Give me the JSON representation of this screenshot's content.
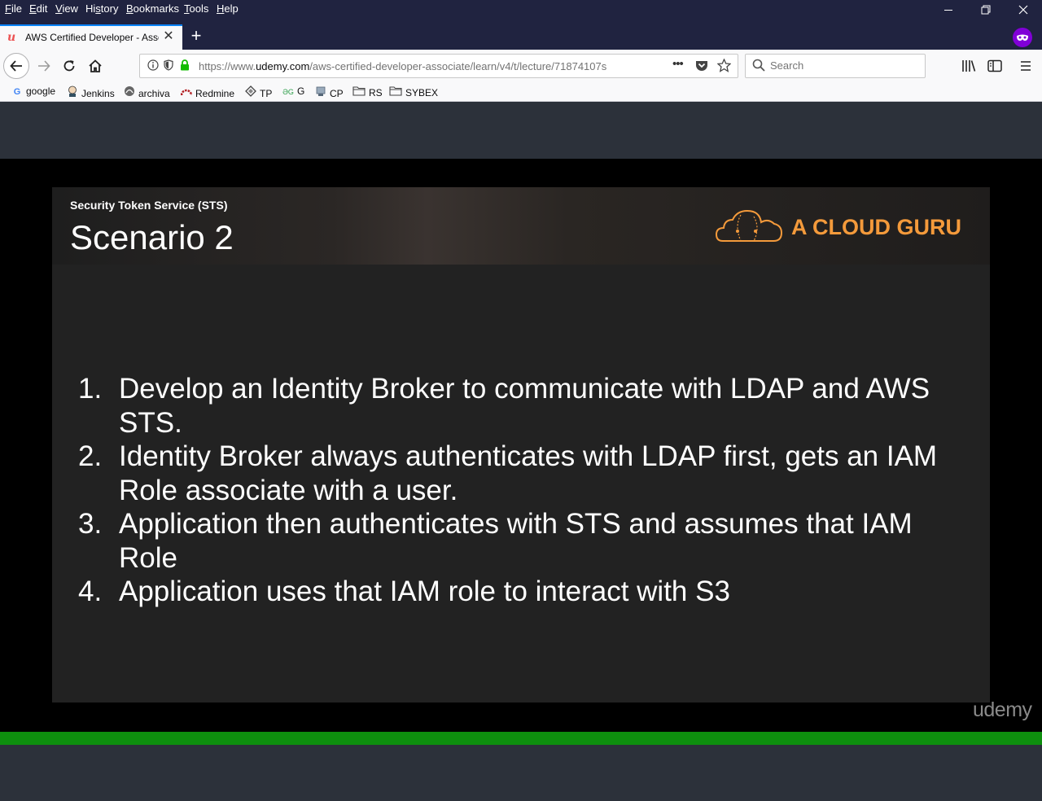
{
  "menu": {
    "items": [
      "File",
      "Edit",
      "View",
      "History",
      "Bookmarks",
      "Tools",
      "Help"
    ],
    "underline": [
      "F",
      "E",
      "V",
      "s",
      "B",
      "T",
      "H"
    ]
  },
  "tab": {
    "title": "AWS Certified Developer - Asso",
    "favicon": "udemy-icon",
    "close_symbol": "✕",
    "new_tab_symbol": "+"
  },
  "urlbar": {
    "url_prefix": "https://www.",
    "url_domain": "udemy.com",
    "url_rest": "/aws-certified-developer-associate/learn/v4/t/lecture/71874107s",
    "page_actions": "•••"
  },
  "search": {
    "placeholder": "Search"
  },
  "bookmarks": [
    {
      "label": "google",
      "icon": "google-icon"
    },
    {
      "label": "Jenkins",
      "icon": "jenkins-icon"
    },
    {
      "label": "archiva",
      "icon": "archiva-icon"
    },
    {
      "label": "Redmine",
      "icon": "redmine-icon"
    },
    {
      "label": "TP",
      "icon": "tp-icon"
    },
    {
      "label": "G",
      "icon": "g-icon"
    },
    {
      "label": "CP",
      "icon": "cp-icon"
    },
    {
      "label": "RS",
      "icon": "folder-icon"
    },
    {
      "label": "SYBEX",
      "icon": "folder-icon"
    }
  ],
  "slide": {
    "kicker": "Security Token Service (STS)",
    "title": "Scenario 2",
    "brand": "A CLOUD GURU",
    "points": [
      {
        "num": "1.",
        "text": "Develop an Identity Broker to communicate with LDAP and AWS STS."
      },
      {
        "num": "2.",
        "text": "Identity Broker always authenticates with LDAP first, gets an IAM Role associate with a user."
      },
      {
        "num": "3.",
        "text": "Application then authenticates with STS and assumes that IAM Role"
      },
      {
        "num": "4.",
        "text": "Application uses that IAM role to interact with S3"
      }
    ]
  },
  "watermark": "udemy",
  "progress": 1.0,
  "colors": {
    "chrome_dark": "#202340",
    "accent_blue": "#0a84ff",
    "brand_orange": "#f49a3b",
    "progress_green": "#0e8f0e",
    "page_background": "#2c313a"
  }
}
